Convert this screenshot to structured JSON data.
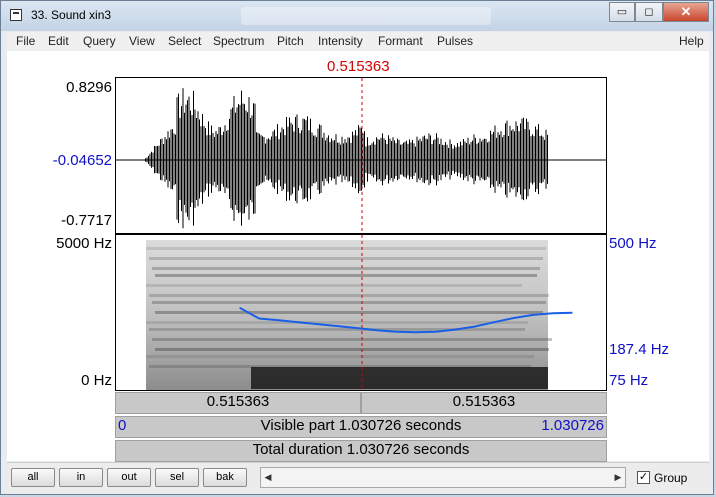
{
  "window": {
    "title": "33. Sound xin3",
    "minimize_glyph": "▭",
    "maximize_glyph": "◻",
    "close_glyph": "✕"
  },
  "menu": [
    "File",
    "Edit",
    "Query",
    "View",
    "Select",
    "Spectrum",
    "Pitch",
    "Intensity",
    "Formant",
    "Pulses"
  ],
  "menu_help": "Help",
  "cursor_time": "0.515363",
  "waveform": {
    "max_label": "0.8296",
    "mid_label": "-0.04652",
    "min_label": "-0.7717"
  },
  "spectrogram": {
    "top_freq": "5000 Hz",
    "bottom_freq": "0 Hz"
  },
  "pitch": {
    "top": "500 Hz",
    "current": "187.4 Hz",
    "bottom": "75 Hz",
    "contour_hz": [
      205,
      180,
      176,
      172,
      168,
      164,
      160,
      156,
      153,
      152,
      153,
      157,
      163,
      172,
      181,
      188,
      192,
      193
    ],
    "contour_start_s": 0.26,
    "contour_end_s": 0.96
  },
  "duration_s": 1.030726,
  "time_bar": {
    "left_segment": "0.515363",
    "right_segment": "0.515363"
  },
  "visible_bar": {
    "start": "0",
    "label": "Visible part 1.030726 seconds",
    "end": "1.030726"
  },
  "total_bar": {
    "label": "Total duration 1.030726 seconds"
  },
  "buttons": {
    "all": "all",
    "in": "in",
    "out": "out",
    "sel": "sel",
    "bak": "bak"
  },
  "scroll_left": "◀",
  "scroll_right": "▶",
  "group": {
    "label": "Group",
    "checked": true,
    "check_glyph": "✓"
  },
  "colors": {
    "cursor": "#d40000",
    "pitch_line": "#1a5fe6",
    "axis_blue": "#1010c8"
  }
}
